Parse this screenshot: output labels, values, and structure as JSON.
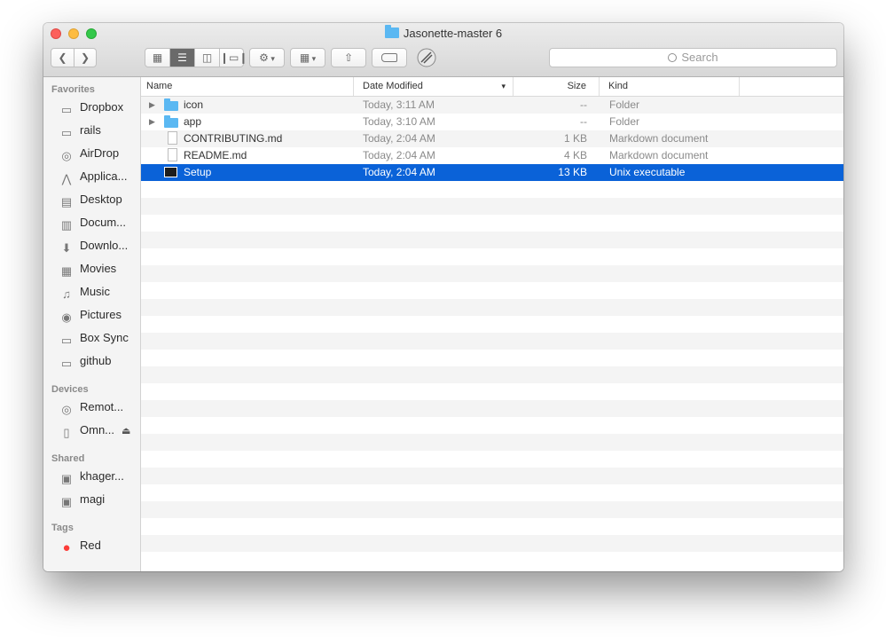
{
  "window": {
    "title": "Jasonette-master 6"
  },
  "toolbar": {
    "back_icon": "chevron-left-icon",
    "forward_icon": "chevron-right-icon",
    "view_icons": [
      "icon-view-icon",
      "list-view-icon",
      "column-view-icon",
      "cover-flow-view-icon"
    ],
    "action_icon": "gear-icon",
    "arrange_icon": "grid-arrange-icon",
    "share_icon": "share-icon",
    "tags_icon": "tag-icon",
    "extra_icon": "app-icon",
    "search_placeholder": "Search"
  },
  "sidebar": {
    "sections": [
      {
        "title": "Favorites",
        "items": [
          {
            "label": "Dropbox",
            "icon": "folder-icon"
          },
          {
            "label": "rails",
            "icon": "folder-icon"
          },
          {
            "label": "AirDrop",
            "icon": "airdrop-icon"
          },
          {
            "label": "Applica...",
            "icon": "applications-icon"
          },
          {
            "label": "Desktop",
            "icon": "desktop-icon"
          },
          {
            "label": "Docum...",
            "icon": "documents-icon"
          },
          {
            "label": "Downlo...",
            "icon": "downloads-icon"
          },
          {
            "label": "Movies",
            "icon": "movies-icon"
          },
          {
            "label": "Music",
            "icon": "music-icon"
          },
          {
            "label": "Pictures",
            "icon": "camera-icon"
          },
          {
            "label": "Box Sync",
            "icon": "folder-icon"
          },
          {
            "label": "github",
            "icon": "folder-icon"
          }
        ]
      },
      {
        "title": "Devices",
        "items": [
          {
            "label": "Remot...",
            "icon": "disc-icon"
          },
          {
            "label": "Omn...",
            "icon": "drive-icon",
            "eject": "⏏"
          }
        ]
      },
      {
        "title": "Shared",
        "items": [
          {
            "label": "khager...",
            "icon": "computer-icon"
          },
          {
            "label": "magi",
            "icon": "computer-icon"
          }
        ]
      },
      {
        "title": "Tags",
        "items": [
          {
            "label": "Red",
            "icon": "red-tag-icon",
            "color": "#fc3d39"
          }
        ]
      }
    ]
  },
  "columns": {
    "name": "Name",
    "date": "Date Modified",
    "size": "Size",
    "kind": "Kind",
    "sort_icon": "chevron-down-icon"
  },
  "files": [
    {
      "name": "icon",
      "date": "Today, 3:11 AM",
      "size": "--",
      "kind": "Folder",
      "type": "folder",
      "expandable": true
    },
    {
      "name": "app",
      "date": "Today, 3:10 AM",
      "size": "--",
      "kind": "Folder",
      "type": "folder",
      "expandable": true
    },
    {
      "name": "CONTRIBUTING.md",
      "date": "Today, 2:04 AM",
      "size": "1 KB",
      "kind": "Markdown document",
      "type": "doc"
    },
    {
      "name": "README.md",
      "date": "Today, 2:04 AM",
      "size": "4 KB",
      "kind": "Markdown document",
      "type": "doc"
    },
    {
      "name": "Setup",
      "date": "Today, 2:04 AM",
      "size": "13 KB",
      "kind": "Unix executable",
      "type": "exec",
      "selected": true
    }
  ],
  "colors": {
    "selection": "#0a62d8",
    "folder": "#5bb8f2",
    "red_tag": "#fc3d39"
  }
}
